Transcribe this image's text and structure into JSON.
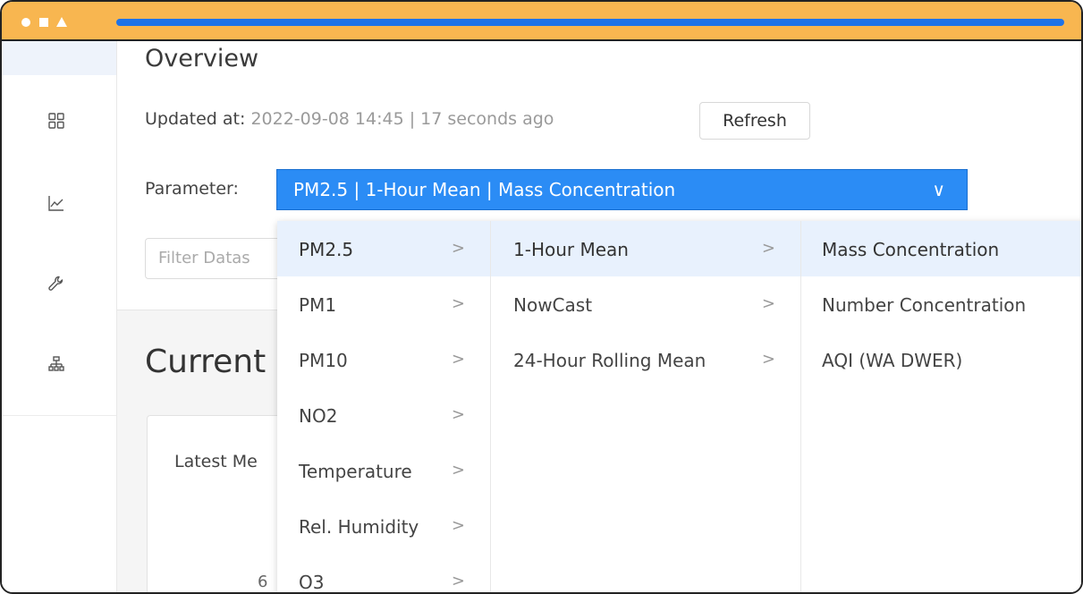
{
  "page": {
    "title": "Overview",
    "updated_label": "Updated at:",
    "updated_timestamp": "2022-09-08 14:45 | 17 seconds ago",
    "refresh_label": "Refresh",
    "parameter_label": "Parameter:",
    "parameter_value": "PM2.5 | 1-Hour Mean | Mass Concentration",
    "filter_placeholder": "Filter Datas",
    "current_heading": "Current",
    "latest_text": "Latest Me",
    "axis_number": "6"
  },
  "icons": {
    "chevron": "∨",
    "arrow": ">"
  },
  "cascader": {
    "col1": [
      {
        "label": "PM2.5",
        "active": true
      },
      {
        "label": "PM1"
      },
      {
        "label": "PM10"
      },
      {
        "label": "NO2"
      },
      {
        "label": "Temperature"
      },
      {
        "label": "Rel. Humidity"
      },
      {
        "label": "O3"
      }
    ],
    "col2": [
      {
        "label": "1-Hour Mean",
        "active": true
      },
      {
        "label": "NowCast"
      },
      {
        "label": "24-Hour Rolling Mean"
      }
    ],
    "col3": [
      {
        "label": "Mass Concentration",
        "active": true
      },
      {
        "label": "Number Concentration"
      },
      {
        "label": "AQI (WA DWER)"
      }
    ]
  },
  "colors": {
    "titlebar": "#f8b650",
    "accent": "#2b8cf5",
    "active_option": "#e8f1fd"
  }
}
